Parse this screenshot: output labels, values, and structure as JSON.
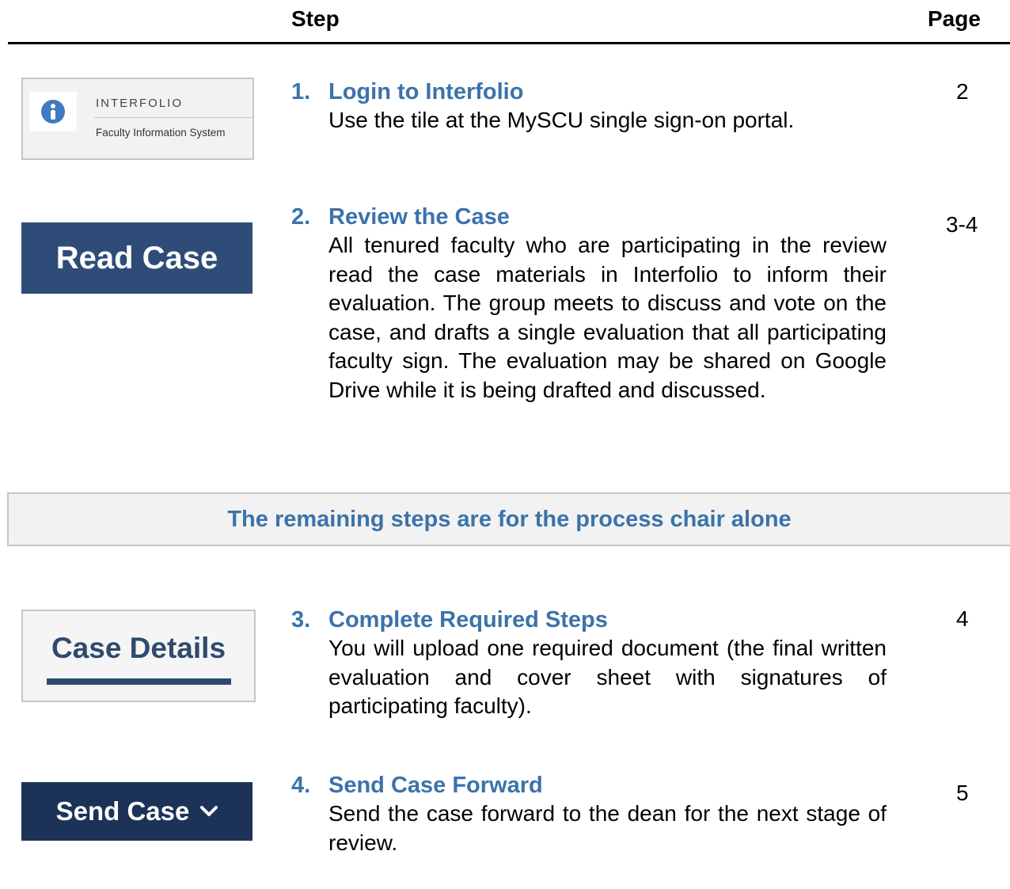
{
  "header": {
    "step_label": "Step",
    "page_label": "Page"
  },
  "tiles": {
    "interfolio_name": "INTERFOLIO",
    "interfolio_subtitle": "Faculty Information System",
    "read_case_label": "Read Case",
    "case_details_label": "Case Details",
    "send_case_label": "Send Case",
    "icons": {
      "info": "info-icon",
      "chevron": "chevron-down-icon"
    },
    "colors": {
      "accent": "#3b73ab",
      "read_case_bg": "#2e4c77",
      "send_case_bg": "#1c3257"
    }
  },
  "steps": [
    {
      "number": "1.",
      "title": "Login to Interfolio",
      "description": "Use the tile at the MySCU single sign-on portal.",
      "page": "2"
    },
    {
      "number": "2.",
      "title": "Review the Case",
      "description": "All tenured faculty who are participating in the review read the case materials in Interfolio to inform their evaluation. The group meets to discuss and vote on the case, and drafts a single evaluation that all participating faculty sign. The evaluation may be shared on Google Drive while it is being drafted and discussed.",
      "page": "3-4"
    },
    {
      "number": "3.",
      "title": "Complete Required Steps",
      "description": "You will upload one required document (the final written evaluation and cover sheet with signatures of participating faculty).",
      "page": "4"
    },
    {
      "number": "4.",
      "title": "Send Case Forward",
      "description": "Send the case forward to the dean for the next stage of review.",
      "page": "5"
    }
  ],
  "banner": {
    "text": "The remaining steps are for the process chair alone"
  }
}
